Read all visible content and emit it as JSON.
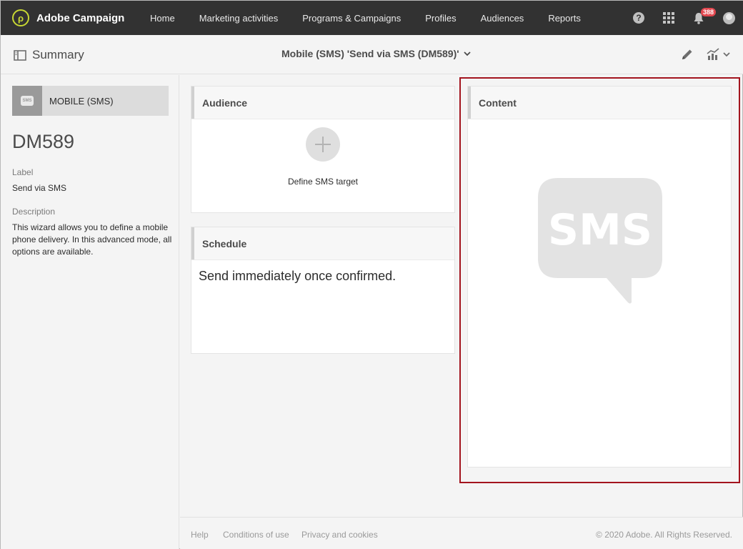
{
  "app": {
    "name": "Adobe Campaign"
  },
  "nav": {
    "items": [
      "Home",
      "Marketing activities",
      "Programs & Campaigns",
      "Profiles",
      "Audiences",
      "Reports"
    ],
    "notification_count": "388"
  },
  "header": {
    "section": "Summary",
    "breadcrumb": "Mobile (SMS) 'Send via SMS (DM589)'"
  },
  "sidebar": {
    "type_label": "MOBILE (SMS)",
    "type_icon_text": "SMS",
    "code": "DM589",
    "label_title": "Label",
    "label_value": "Send via SMS",
    "description_title": "Description",
    "description_value": "This wizard allows you to define a mobile phone delivery. In this advanced mode, all options are available."
  },
  "audience": {
    "title": "Audience",
    "action": "Define SMS target"
  },
  "schedule": {
    "title": "Schedule",
    "text": "Send immediately once confirmed."
  },
  "content": {
    "title": "Content",
    "placeholder_text": "SMS"
  },
  "footer": {
    "links": [
      "Help",
      "Conditions of use",
      "Privacy and cookies"
    ],
    "copyright": "© 2020 Adobe. All Rights Reserved."
  },
  "colors": {
    "topbar": "#323232",
    "brand_accent": "#c8d833",
    "highlight": "#a3141e",
    "badge": "#e34850"
  }
}
